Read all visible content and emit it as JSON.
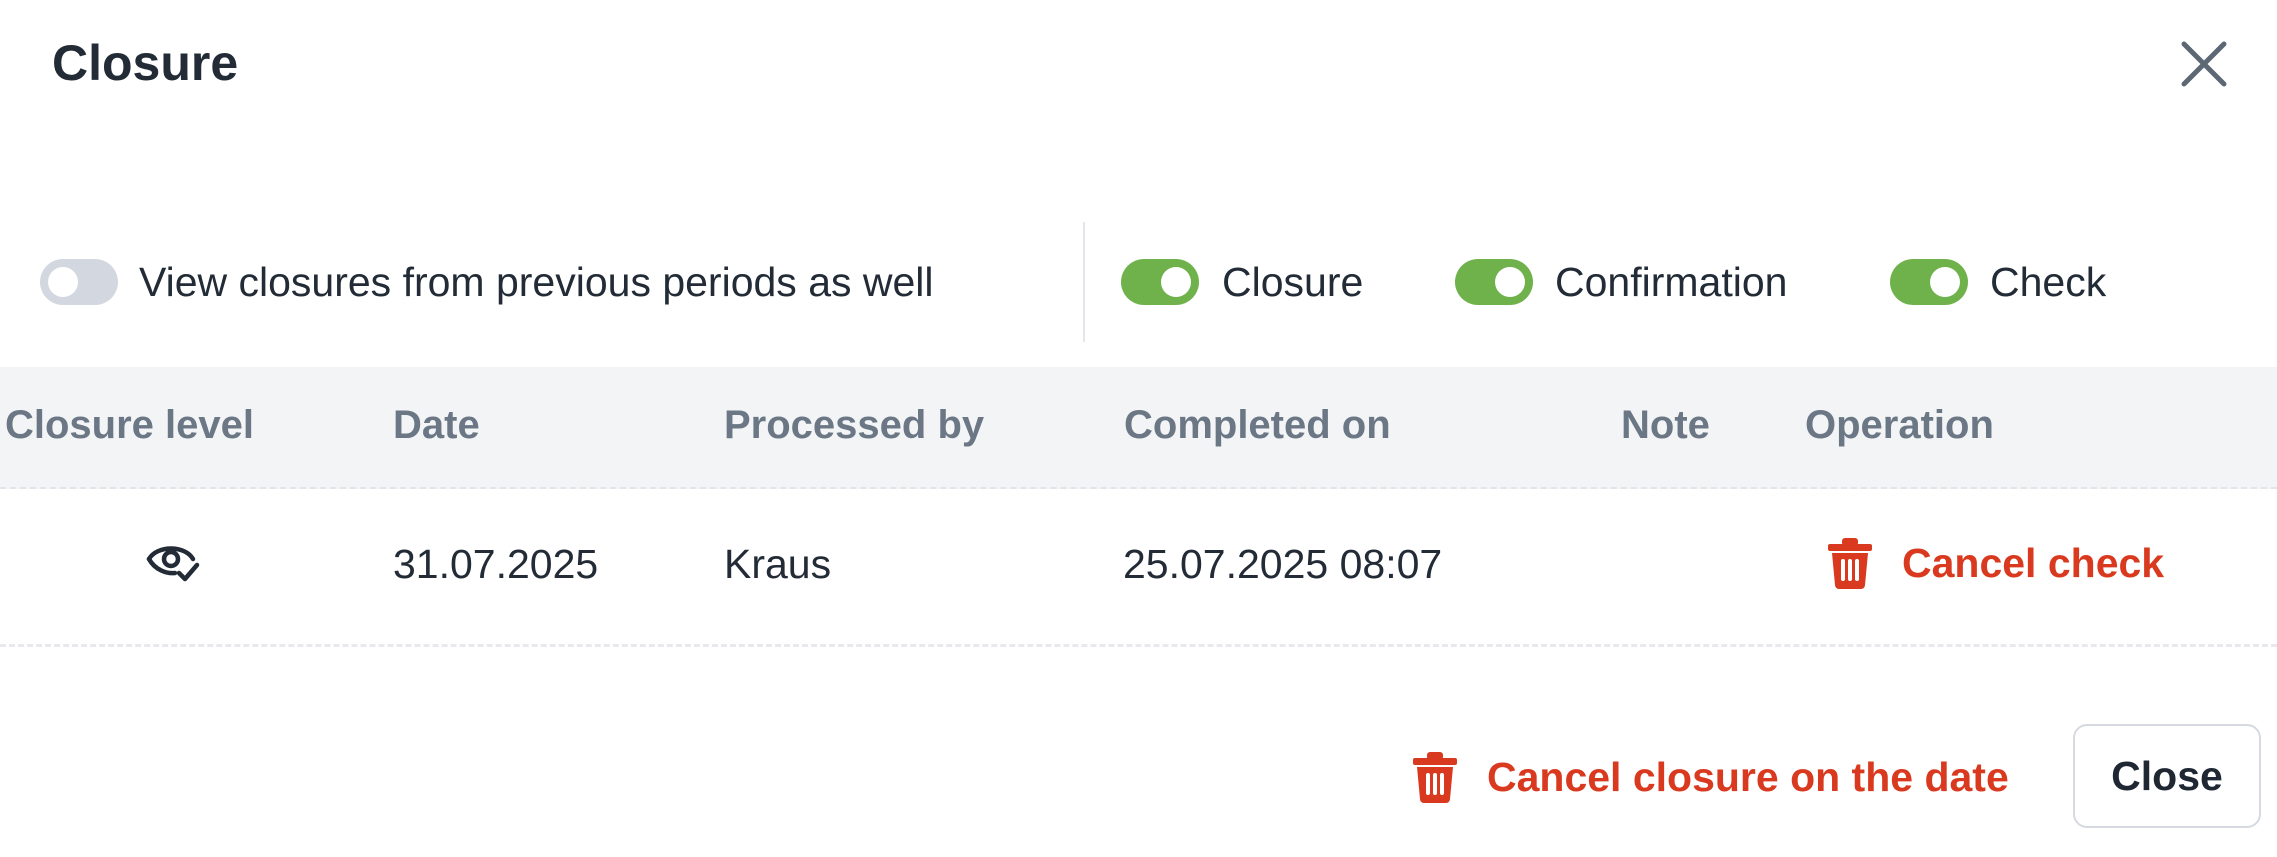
{
  "dialog": {
    "title": "Closure"
  },
  "filters": {
    "previous_periods": {
      "label": "View closures from previous periods as well",
      "on": false
    },
    "closure": {
      "label": "Closure",
      "on": true
    },
    "confirmation": {
      "label": "Confirmation",
      "on": true
    },
    "check": {
      "label": "Check",
      "on": true
    }
  },
  "table": {
    "headers": {
      "closure_level": "Closure level",
      "date": "Date",
      "processed_by": "Processed by",
      "completed_on": "Completed on",
      "note": "Note",
      "operation": "Operation"
    },
    "rows": [
      {
        "closure_level_icon": "eye-check-icon",
        "date": "31.07.2025",
        "processed_by": "Kraus",
        "completed_on": "25.07.2025 08:07",
        "note": "",
        "operation": "Cancel check"
      }
    ]
  },
  "footer": {
    "cancel_closure_label": "Cancel closure on the date",
    "close_label": "Close"
  },
  "colors": {
    "toggle_on": "#6fb24b",
    "toggle_off": "#d3d7df",
    "danger": "#d93a1f",
    "header_bg": "#f3f4f6"
  }
}
